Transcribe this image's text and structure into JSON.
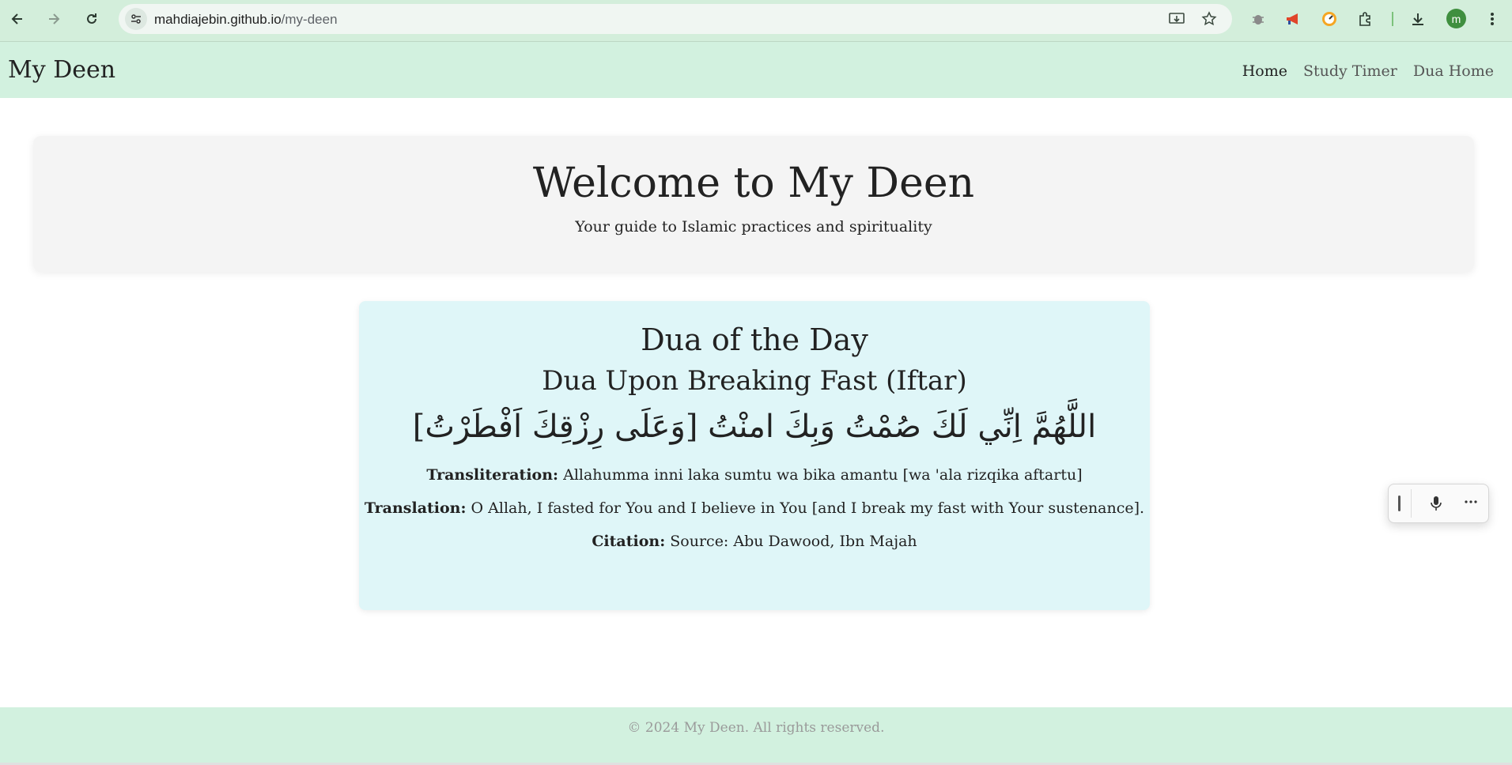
{
  "browser": {
    "url_host": "mahdiajebin.github.io",
    "url_path": "/my-deen",
    "profile_initial": "m"
  },
  "site": {
    "brand": "My Deen",
    "nav": [
      {
        "label": "Home",
        "active": true
      },
      {
        "label": "Study Timer",
        "active": false
      },
      {
        "label": "Dua Home",
        "active": false
      }
    ]
  },
  "hero": {
    "title": "Welcome to My Deen",
    "subtitle": "Your guide to Islamic practices and spirituality"
  },
  "dua": {
    "section_title": "Dua of the Day",
    "name": "Dua Upon Breaking Fast (Iftar)",
    "arabic": "اللَّهُمَّ اِنِّي لَكَ صُمْتُ وَبِكَ امنْتُ [وَعَلَى رِزْقِكَ اَفْطَرْتُ]",
    "transliteration_label": "Transliteration:",
    "transliteration": " Allahumma inni laka sumtu wa bika amantu [wa 'ala rizqika aftartu]",
    "translation_label": "Translation:",
    "translation": " O Allah, I fasted for You and I believe in You [and I break my fast with Your sustenance].",
    "citation_label": "Citation:",
    "citation": " Source: Abu Dawood, Ibn Majah"
  },
  "footer": {
    "text": "© 2024 My Deen. All rights reserved."
  },
  "colors": {
    "chrome_bg": "#d3eedb",
    "header_bg": "#d2f1df",
    "hero_bg": "#f4f4f4",
    "dua_bg": "#dff6f8"
  }
}
